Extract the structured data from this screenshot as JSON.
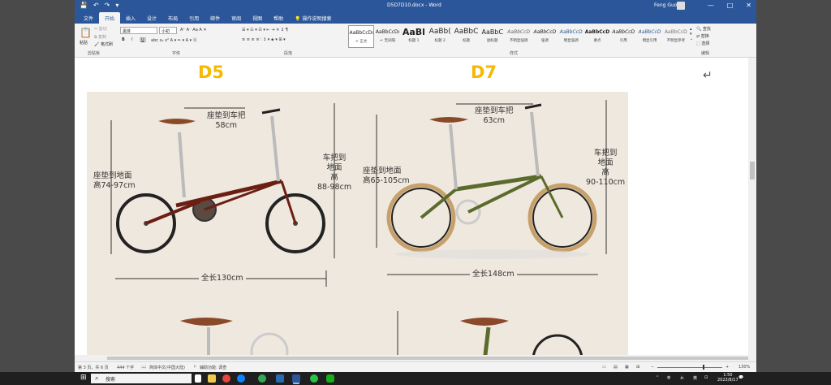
{
  "window": {
    "title": "D5D7D10.docx  -  Word",
    "user": "Feng Guo",
    "controls": [
      "—",
      "□",
      "✕"
    ]
  },
  "qat": [
    "💾",
    "↶",
    "↷",
    "▾"
  ],
  "tabs": [
    "文件",
    "开始",
    "插入",
    "设计",
    "布局",
    "引用",
    "邮件",
    "审阅",
    "视图",
    "帮助",
    "操作说明搜索"
  ],
  "ribbon": {
    "clipboard": {
      "paste": "粘贴",
      "cut": "剪切",
      "copy": "复制",
      "format_painter": "格式刷",
      "label": "剪贴板"
    },
    "font": {
      "name": "黑体",
      "size": "小初",
      "label": "字体",
      "bold": "B",
      "italic": "I",
      "underline": "U"
    },
    "paragraph": {
      "label": "段落"
    },
    "styles": {
      "label": "样式",
      "items": [
        {
          "preview": "AaBbCcDı",
          "name": "↵ 正文"
        },
        {
          "preview": "AaBbCcDı",
          "name": "↵ 无间隔"
        },
        {
          "preview": "AaBl",
          "name": "标题 1"
        },
        {
          "preview": "AaBb(",
          "name": "标题 2"
        },
        {
          "preview": "AaBbC",
          "name": "标题"
        },
        {
          "preview": "AaBbC",
          "name": "副标题"
        },
        {
          "preview": "AaBbCcD",
          "name": "不明显强调"
        },
        {
          "preview": "AaBbCcD",
          "name": "强调"
        },
        {
          "preview": "AaBbCcD",
          "name": "明显强调"
        },
        {
          "preview": "AaBbCcD",
          "name": "要点"
        },
        {
          "preview": "AaBbCcD",
          "name": "引用"
        },
        {
          "preview": "AaBbCcD",
          "name": "明显引用"
        },
        {
          "preview": "AaBbCcD",
          "name": "不明显参考"
        }
      ]
    },
    "editing": {
      "find": "查找",
      "replace": "替换",
      "select": "选择",
      "label": "编辑"
    }
  },
  "document": {
    "left_model": "D5",
    "right_model": "D7",
    "d5": {
      "saddle_to_bar": "座垫到车把",
      "saddle_to_bar_value": "58cm",
      "bar_to_ground": "车把到",
      "bar_to_ground_2": "地面",
      "bar_to_ground_3": "高",
      "bar_to_ground_value": "88-98cm",
      "seat_to_ground": "座垫到地面",
      "seat_to_ground_value": "高74-97cm",
      "length": "全长130cm",
      "frame_color": "#6b1f14"
    },
    "d7": {
      "saddle_to_bar": "座垫到车把",
      "saddle_to_bar_value": "63cm",
      "bar_to_ground": "车把到",
      "bar_to_ground_2": "地面",
      "bar_to_ground_3": "高",
      "bar_to_ground_value": "90-110cm",
      "seat_to_ground": "座垫到地面",
      "seat_to_ground_value": "高65-105cm",
      "length": "全长148cm",
      "frame_color": "#5a6b2c"
    }
  },
  "status": {
    "page": "第 3 页，共 6 页",
    "words": "444 个字",
    "lang": "简体中文(中国大陆)",
    "accessibility": "辅助功能: 调查",
    "zoom": "130%"
  },
  "taskbar": {
    "search_placeholder": "搜索",
    "tray_lang": "英",
    "time": "1:50",
    "date": "2023/8/17"
  }
}
